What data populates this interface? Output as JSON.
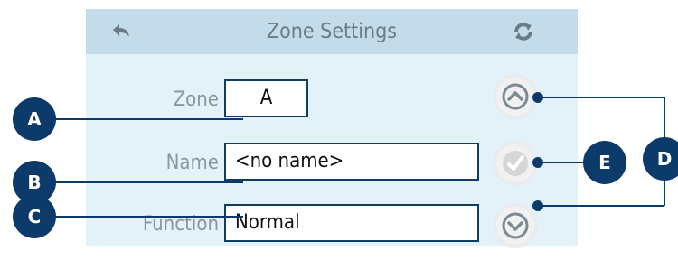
{
  "header": {
    "title": "Zone Settings",
    "back_icon": "back-arrow-icon",
    "refresh_icon": "refresh-icon"
  },
  "form": {
    "zone": {
      "label": "Zone",
      "value": "A"
    },
    "name": {
      "label": "Name",
      "value": "<no name>"
    },
    "function": {
      "label": "Function",
      "value": "Normal"
    }
  },
  "buttons": {
    "up_icon": "chevron-up-icon",
    "confirm_icon": "checkmark-icon",
    "down_icon": "chevron-down-icon"
  },
  "callouts": {
    "a": "A",
    "b": "B",
    "c": "C",
    "d": "D",
    "e": "E"
  },
  "colors": {
    "panel_bg": "#e3f2f9",
    "header_bg": "#c4dcea",
    "callout": "#0c3a6a"
  }
}
